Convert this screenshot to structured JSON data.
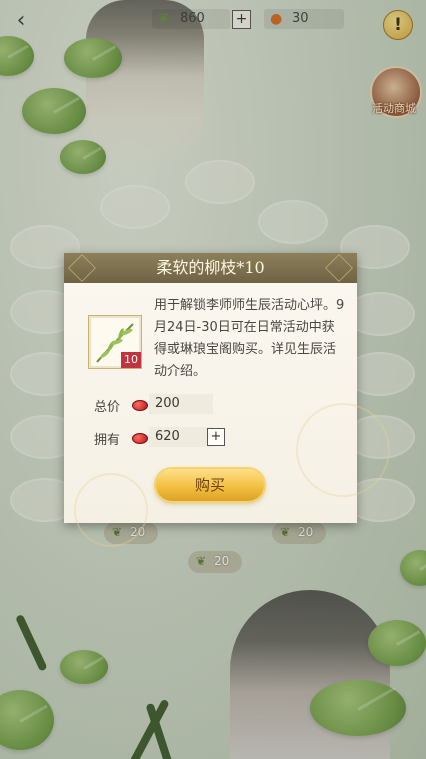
{
  "top_bar": {
    "branch_count": "860",
    "plus_label": "+",
    "currency_count": "30",
    "alert_label": "!"
  },
  "side": {
    "shop_label": "活动商城"
  },
  "dialog": {
    "title": "柔软的柳枝*10",
    "item_badge": "10",
    "description": "用于解锁李师师生辰活动心坪。9月24日-30日可在日常活动中获得或琳琅宝阁购买。详见生辰活动介绍。",
    "total_label": "总价",
    "total_value": "200",
    "own_label": "拥有",
    "own_value": "620",
    "own_plus": "+",
    "buy_label": "购买"
  },
  "grid_chips": [
    "20",
    "20",
    "20"
  ],
  "icons": {
    "back": "back-arrow-icon",
    "branch": "willow-branch-icon",
    "currency": "red-bean-icon",
    "alert": "exclamation-icon",
    "shop": "activity-shop-icon"
  },
  "colors": {
    "header": "#7d7050",
    "button": "#f1bd3c",
    "badge": "#c0343f"
  }
}
